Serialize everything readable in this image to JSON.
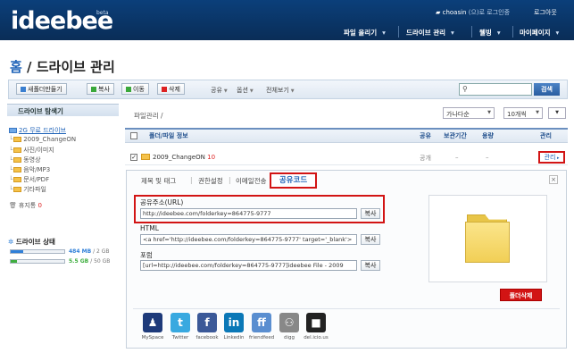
{
  "header": {
    "logo": "ideebee",
    "beta": "beta",
    "user_name": "choasin",
    "user_suffix": "(으)로 로그인중",
    "logout": "로그아웃",
    "nav": [
      "파일 올리기",
      "드라이브 관리",
      "웰빙",
      "마이페이지"
    ]
  },
  "page": {
    "title_home": "홈",
    "title_rest": " / 드라이브 관리"
  },
  "toolbar": {
    "new_folder": "새폴더만들기",
    "copy": "복사",
    "move": "이동",
    "delete": "삭제",
    "share": "공유",
    "options": "옵션",
    "select_all": "전체보기",
    "search_placeholder": "",
    "search_button": "검색"
  },
  "sidebar": {
    "title": "드라이브 탐색기",
    "root": "2G 무료 드라이브",
    "folders": [
      "2009_ChangeON",
      "사진/이미지",
      "동영상",
      "음악/MP3",
      "문서/PDF",
      "기타파일"
    ],
    "trash": "휴지통",
    "trash_count": "0",
    "storage_title": "드라이브 상태",
    "storage": [
      {
        "used": "484 MB",
        "total": "2 GB",
        "ratio": 0.24,
        "color": "#2f7fd8"
      },
      {
        "used": "5.5 GB",
        "total": "50 GB",
        "ratio": 0.11,
        "color": "#3fae3f"
      }
    ]
  },
  "main": {
    "breadcrumb": "파일관리 /",
    "sort": "가나다순",
    "per_page": "10개씩",
    "columns": {
      "name": "폴더/파일 정보",
      "share": "공유",
      "period": "보관기간",
      "size": "용량",
      "manage": "관리"
    },
    "row": {
      "name": "2009_ChangeON",
      "count": "10",
      "share": "공개",
      "period": "–",
      "size": "–",
      "manage": "관리"
    }
  },
  "panel": {
    "tabs": [
      "제목 및 태그",
      "권한설정",
      "이메일전송"
    ],
    "active_tab": "공유코드",
    "url_label": "공유주소(URL)",
    "url_value": "http://ideebee.com/folderkey=864775-9777",
    "html_label": "HTML",
    "html_value": "<a href='http://ideebee.com/folderkey=864775-9777' target='_blank'>",
    "forum_label": "포럼",
    "forum_value": "[url=http://ideebee.com/folderkey=864775-9777]ideebee File - 2009",
    "copy_label": "복사",
    "delete_folder": "폴더삭제",
    "close": "×",
    "share_services": [
      {
        "name": "MySpace",
        "icon": "myspace-icon",
        "color": "#1e3a7a",
        "glyph": "♟"
      },
      {
        "name": "Twitter",
        "icon": "twitter-icon",
        "color": "#39a9e0",
        "glyph": "t"
      },
      {
        "name": "facebook",
        "icon": "facebook-icon",
        "color": "#3b5998",
        "glyph": "f"
      },
      {
        "name": "Linkedin",
        "icon": "linkedin-icon",
        "color": "#0b78b7",
        "glyph": "in"
      },
      {
        "name": "friendfeed",
        "icon": "friendfeed-icon",
        "color": "#5a8ed0",
        "glyph": "ff"
      },
      {
        "name": "digg",
        "icon": "digg-icon",
        "color": "#888888",
        "glyph": "⚇"
      },
      {
        "name": "del.icio.us",
        "icon": "delicious-icon",
        "color": "#222222",
        "glyph": "■"
      }
    ]
  }
}
